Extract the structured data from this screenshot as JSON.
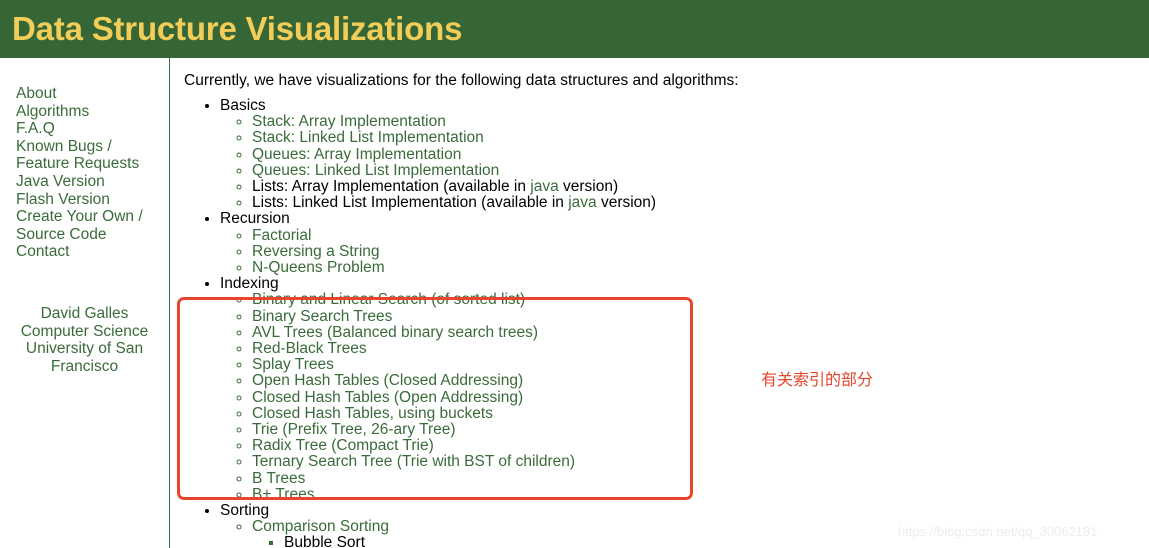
{
  "header": {
    "title": "Data Structure Visualizations"
  },
  "sidebar": {
    "items": [
      {
        "label": "About"
      },
      {
        "label": "Algorithms"
      },
      {
        "label": "F.A.Q"
      },
      {
        "label": "Known Bugs / Feature Requests"
      },
      {
        "label": "Java Version"
      },
      {
        "label": "Flash Version"
      },
      {
        "label": "Create Your Own / Source Code"
      },
      {
        "label": "Contact"
      }
    ],
    "author": {
      "name": "David Galles",
      "department": "Computer Science",
      "university_line1": "University of San",
      "university_line2": "Francisco"
    }
  },
  "main": {
    "intro": "Currently, we have visualizations for the following data structures and algorithms:",
    "sections": [
      {
        "title": "Basics",
        "items": [
          {
            "text": "Stack: Array Implementation",
            "type": "link"
          },
          {
            "text": "Stack: Linked List Implementation",
            "type": "link"
          },
          {
            "text": "Queues: Array Implementation",
            "type": "link"
          },
          {
            "text": "Queues: Linked List Implementation",
            "type": "link"
          },
          {
            "type": "mixed",
            "prefix": "Lists: Array Implementation (available in ",
            "link": "java",
            "suffix": " version)"
          },
          {
            "type": "mixed",
            "prefix": "Lists: Linked List Implementation (available in ",
            "link": "java",
            "suffix": " version)"
          }
        ]
      },
      {
        "title": "Recursion",
        "items": [
          {
            "text": "Factorial",
            "type": "link"
          },
          {
            "text": "Reversing a String",
            "type": "link"
          },
          {
            "text": "N-Queens Problem",
            "type": "link"
          }
        ]
      },
      {
        "title": "Indexing",
        "items": [
          {
            "text": "Binary and Linear Search (of sorted list)",
            "type": "link"
          },
          {
            "text": "Binary Search Trees",
            "type": "link"
          },
          {
            "text": "AVL Trees (Balanced binary search trees)",
            "type": "link"
          },
          {
            "text": "Red-Black Trees",
            "type": "link"
          },
          {
            "text": "Splay Trees",
            "type": "link"
          },
          {
            "text": "Open Hash Tables (Closed Addressing)",
            "type": "link"
          },
          {
            "text": "Closed Hash Tables (Open Addressing)",
            "type": "link"
          },
          {
            "text": "Closed Hash Tables, using buckets",
            "type": "link"
          },
          {
            "text": "Trie (Prefix Tree, 26-ary Tree)",
            "type": "link"
          },
          {
            "text": "Radix Tree (Compact Trie)",
            "type": "link"
          },
          {
            "text": "Ternary Search Tree (Trie with BST of children)",
            "type": "link"
          },
          {
            "text": "B Trees",
            "type": "link"
          },
          {
            "text": "B+ Trees",
            "type": "link"
          }
        ]
      },
      {
        "title": "Sorting",
        "items": [
          {
            "text": "Comparison Sorting",
            "type": "link"
          }
        ],
        "subitems": [
          {
            "text": "Bubble Sort",
            "type": "plain"
          }
        ]
      }
    ]
  },
  "annotations": {
    "indexing_note": "有关索引的部分",
    "watermark": "https://blog.csdn.net/qq_30062181"
  },
  "colors": {
    "header_bg": "#366536",
    "header_text": "#f2ce58",
    "link_green": "#3a6b3a",
    "annotation_red": "#e8452c",
    "body_text": "#000000"
  }
}
